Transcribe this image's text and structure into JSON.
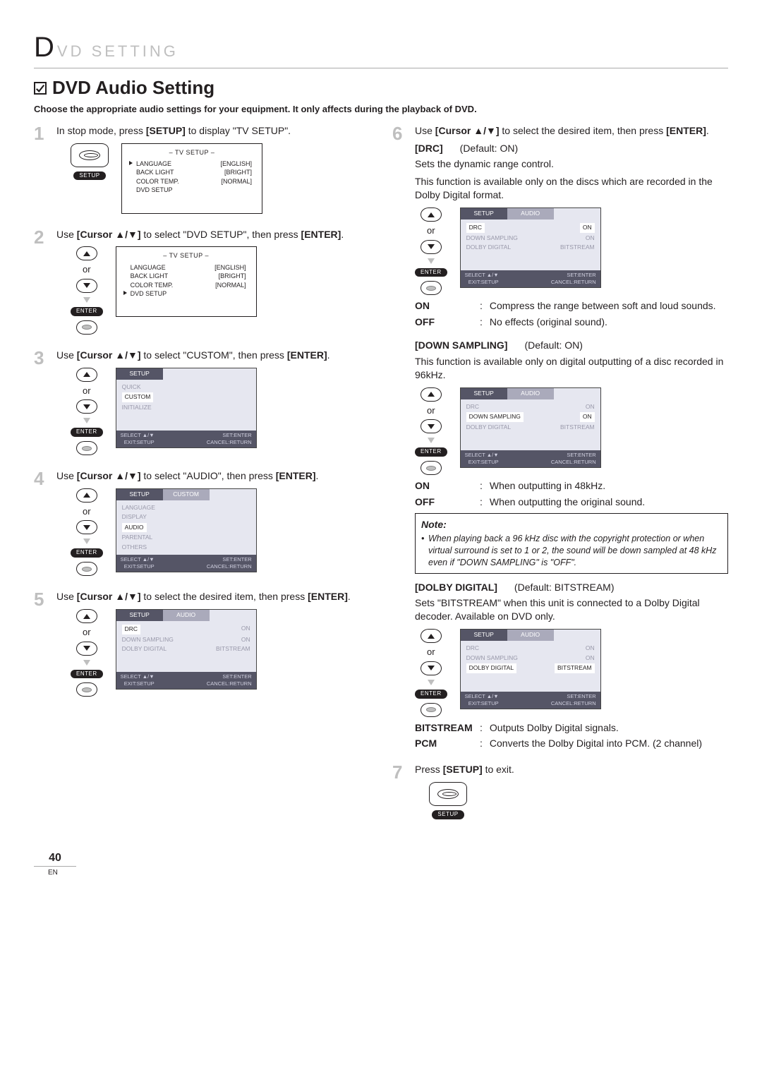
{
  "header": {
    "first_letter": "D",
    "rest": "VD SETTING"
  },
  "section": {
    "title": "DVD Audio Setting",
    "intro": "Choose the appropriate audio settings for your equipment. It only affects during the playback of DVD."
  },
  "labels": {
    "or": "or",
    "setup_pill": "SETUP",
    "enter_pill": "ENTER",
    "select_hint": "SELECT ▲/▼",
    "exit_hint": "EXIT:SETUP",
    "set_hint": "SET:ENTER",
    "cancel_hint": "CANCEL:RETURN"
  },
  "steps": [
    {
      "num": "1",
      "text_pre": "In stop mode, press ",
      "bold": "[SETUP]",
      "text_post": " to display \"TV SETUP\"."
    },
    {
      "num": "2",
      "text_pre": "Use ",
      "bold": "[Cursor ▲/▼]",
      "text_mid": " to select \"DVD SETUP\", then press ",
      "bold2": "[ENTER]",
      "text_post": "."
    },
    {
      "num": "3",
      "text_pre": "Use ",
      "bold": "[Cursor ▲/▼]",
      "text_mid": " to select \"CUSTOM\", then press ",
      "bold2": "[ENTER]",
      "text_post": "."
    },
    {
      "num": "4",
      "text_pre": "Use ",
      "bold": "[Cursor ▲/▼]",
      "text_mid": " to select \"AUDIO\", then press ",
      "bold2": "[ENTER]",
      "text_post": "."
    },
    {
      "num": "5",
      "text_pre": "Use ",
      "bold": "[Cursor ▲/▼]",
      "text_mid": " to select the desired item, then press ",
      "bold2": "[ENTER]",
      "text_post": "."
    },
    {
      "num": "6",
      "text_pre": "Use ",
      "bold": "[Cursor ▲/▼]",
      "text_mid": " to select the desired item, then press ",
      "bold2": "[ENTER]",
      "text_post": "."
    },
    {
      "num": "7",
      "text_pre": "Press ",
      "bold": "[SETUP]",
      "text_post": " to exit."
    }
  ],
  "osd_tv": {
    "title": "– TV SETUP –",
    "rows": [
      {
        "l": "LANGUAGE",
        "r": "[ENGLISH]"
      },
      {
        "l": "BACK LIGHT",
        "r": "[BRIGHT]"
      },
      {
        "l": "COLOR TEMP.",
        "r": "[NORMAL]"
      },
      {
        "l": "DVD SETUP",
        "r": ""
      }
    ]
  },
  "osd_tabs": {
    "setup": "SETUP",
    "custom": "CUSTOM",
    "audio": "AUDIO"
  },
  "osd_setup_menu": {
    "items": [
      "QUICK",
      "CUSTOM",
      "INITIALIZE"
    ],
    "highlight": 1
  },
  "osd_custom_menu": {
    "items": [
      "LANGUAGE",
      "DISPLAY",
      "AUDIO",
      "PARENTAL",
      "OTHERS"
    ],
    "highlight": 2
  },
  "osd_audio_menu": {
    "items": [
      {
        "l": "DRC",
        "r": "ON"
      },
      {
        "l": "DOWN SAMPLING",
        "r": "ON"
      },
      {
        "l": "DOLBY DIGITAL",
        "r": "BITSTREAM"
      }
    ]
  },
  "drc": {
    "heading": "[DRC]",
    "default": "(Default: ON)",
    "desc1": "Sets the dynamic range control.",
    "desc2": "This function is available only on the discs which are recorded in the Dolby Digital format.",
    "options": [
      {
        "term": "ON",
        "def": "Compress the range between soft and loud sounds."
      },
      {
        "term": "OFF",
        "def": "No effects (original sound)."
      }
    ]
  },
  "down": {
    "heading": "[DOWN SAMPLING]",
    "default": "(Default: ON)",
    "desc": "This function is available only on digital outputting of a disc recorded in 96kHz.",
    "options": [
      {
        "term": "ON",
        "def": "When outputting in 48kHz."
      },
      {
        "term": "OFF",
        "def": "When outputting the original sound."
      }
    ]
  },
  "note": {
    "title": "Note:",
    "text": "When playing back a 96 kHz disc with the copyright protection or when virtual surround is set to 1 or 2, the sound will be down sampled at 48 kHz even if \"DOWN SAMPLING\" is \"OFF\"."
  },
  "dolby": {
    "heading": "[DOLBY DIGITAL]",
    "default": "(Default: BITSTREAM)",
    "desc": "Sets \"BITSTREAM\" when this unit is connected to a Dolby Digital decoder. Available on DVD only.",
    "options": [
      {
        "term": "BITSTREAM",
        "def": "Outputs Dolby Digital signals."
      },
      {
        "term": "PCM",
        "def": "Converts the Dolby Digital into PCM. (2 channel)"
      }
    ]
  },
  "footer": {
    "page": "40",
    "lang": "EN"
  }
}
